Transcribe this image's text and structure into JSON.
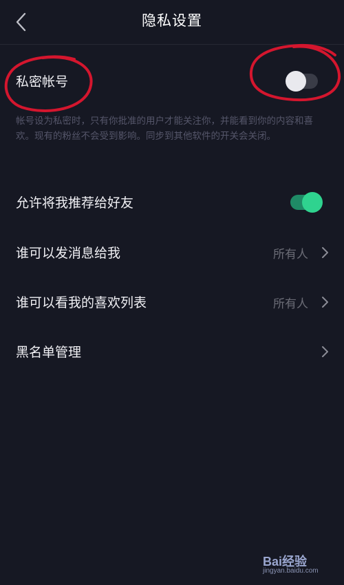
{
  "header": {
    "title": "隐私设置",
    "back_icon": "chevron-left-icon"
  },
  "private_account": {
    "label": "私密帐号",
    "enabled": false,
    "description": "帐号设为私密时，只有你批准的用户才能关注你，并能看到你的内容和喜欢。现有的粉丝不会受到影响。同步到其他软件的开关会关闭。"
  },
  "recommend": {
    "label": "允许将我推荐给好友",
    "enabled": true
  },
  "settings": [
    {
      "label": "谁可以发消息给我",
      "value": "所有人"
    },
    {
      "label": "谁可以看我的喜欢列表",
      "value": "所有人"
    },
    {
      "label": "黑名单管理",
      "value": ""
    }
  ],
  "watermark": {
    "logo": "Bai经验",
    "url": "jingyan.baidu.com"
  },
  "colors": {
    "background": "#161823",
    "toggle_on": "#2fd38f",
    "annotation": "#d4162e"
  }
}
